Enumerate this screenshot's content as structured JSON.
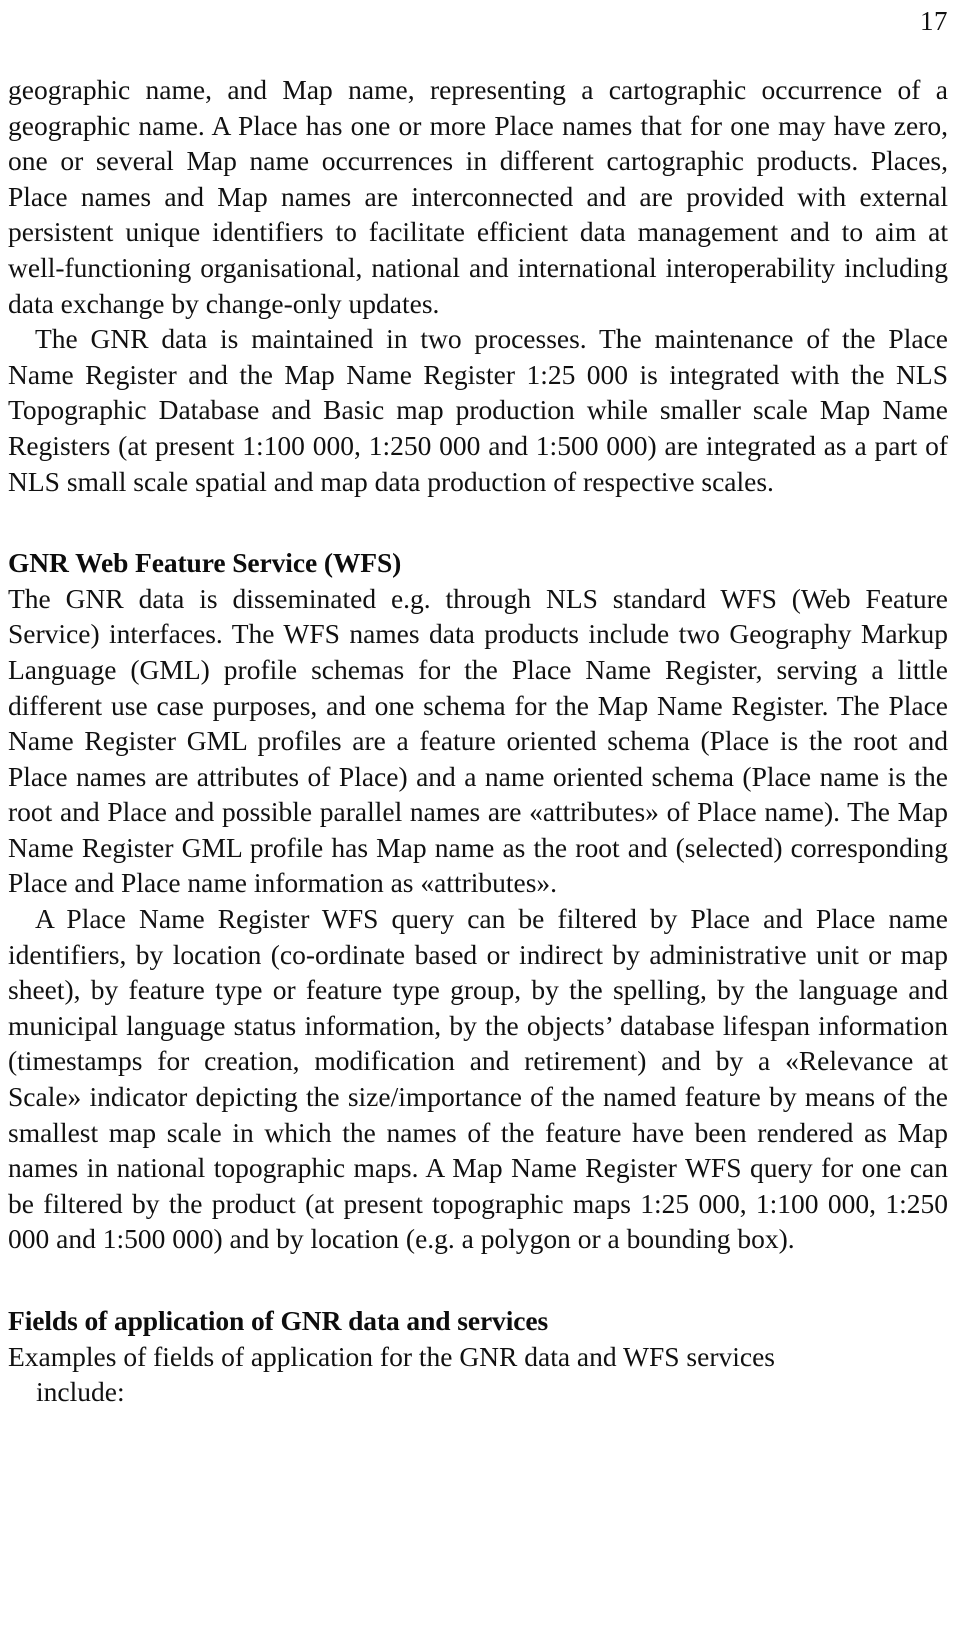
{
  "document": {
    "page_number": "17",
    "paragraphs": [
      {
        "id": "p1",
        "indent": false,
        "text": "geographic name, and Map name, representing a cartographic occurrence of a geographic name. A Place has one or more Place names that for one may have zero, one or several Map name occurrences in different cartographic products. Places, Place names and Map names are interconnected and are provided with external persistent unique identifiers to facilitate efficient data management and to aim at well-functioning organisational, national and international interoperability including data exchange by change-only updates."
      },
      {
        "id": "p2",
        "indent": true,
        "text": "The GNR data is maintained in two processes. The maintenance of the Place Name Register and the Map Name Register 1:25 000 is integrated with the NLS Topographic Database and Basic map production while smaller scale Map Name Registers (at present 1:100 000, 1:250 000 and 1:500 000) are integrated as a part of NLS small scale spatial and map data production of respective scales."
      },
      {
        "id": "p3",
        "indent": false,
        "text": "The GNR data is disseminated e.g. through NLS standard WFS (Web Feature Service) interfaces. The WFS names data products include two Geography Markup Language (GML) profile schemas for the Place Name Register, serving a little different use case purposes, and one schema for the Map Name Register. The Place Name Register GML profiles are a feature oriented schema (Place is the root and Place names are attributes of Place) and a name oriented schema (Place name is the root and Place and possible parallel names are «attributes» of Place name). The Map Name Register GML profile has Map name as the root and (selected) corresponding Place and Place name information as «attributes»."
      },
      {
        "id": "p4",
        "indent": true,
        "text": "A Place Name Register WFS query can be filtered by Place and Place name identifiers, by location (co-ordinate based or indirect by administrative unit or map sheet), by feature type or feature type group, by the spelling, by the language and municipal language status information, by the objects’ database lifespan information (timestamps for creation, modification and retirement) and by a «Relevance at Scale» indicator depicting the size/importance of the named feature by means of the smallest map scale in which the names of the feature have been rendered as Map names in national topographic maps. A Map Name Register WFS query for one can be filtered by the product (at present topographic maps 1:25 000, 1:100 000, 1:250 000 and 1:500 000) and by location (e.g. a polygon or a bounding box)."
      },
      {
        "id": "p5",
        "indent": false,
        "text": "Examples of fields of application for the GNR data and WFS services"
      }
    ],
    "headings": [
      {
        "id": "h1",
        "text": "GNR Web Feature Service (WFS)"
      },
      {
        "id": "h2",
        "text": "Fields of application of GNR data and services"
      }
    ],
    "trailing_line": "include:"
  }
}
